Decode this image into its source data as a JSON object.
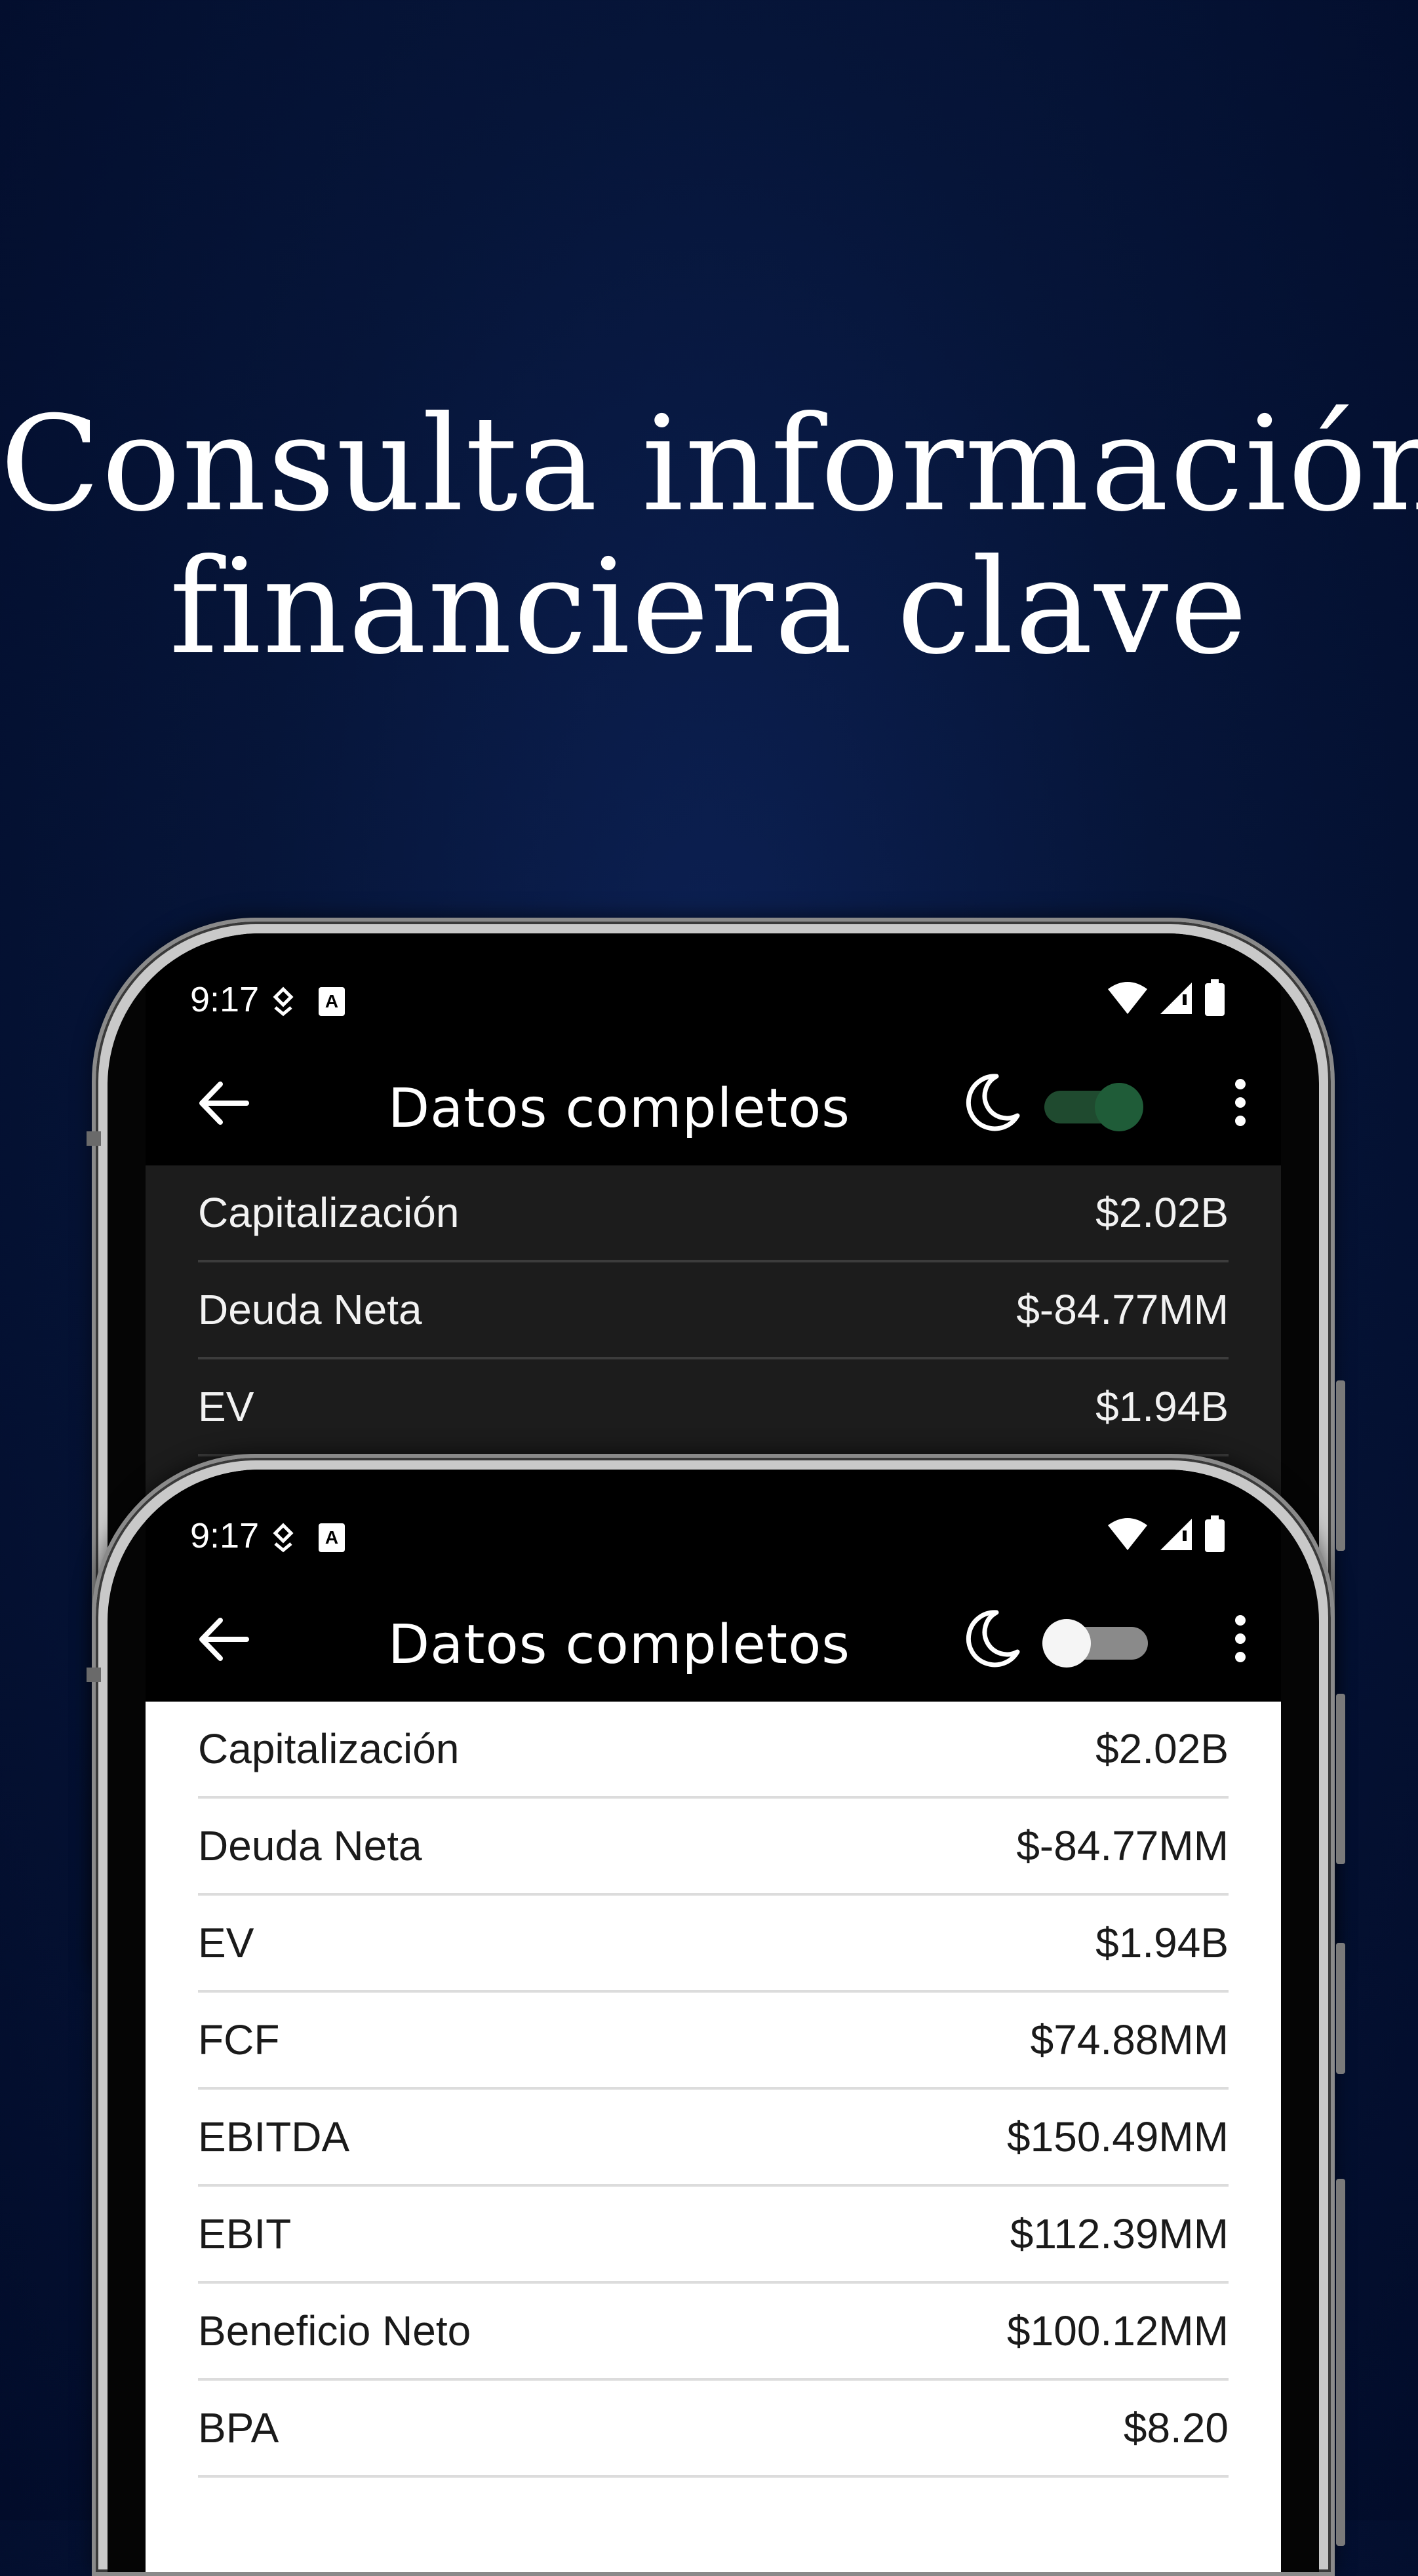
{
  "headline": {
    "line1": "Consulta información",
    "line2": "financiera clave"
  },
  "status_bar": {
    "time": "9:17",
    "icons": [
      "notification-icon",
      "a-icon",
      "wifi-icon",
      "signal-icon",
      "battery-icon"
    ]
  },
  "app_bar": {
    "title": "Datos completos",
    "icons": [
      "back-arrow-icon",
      "moon-icon",
      "more-vert-icon"
    ]
  },
  "dark_phone": {
    "dark_mode_enabled": true,
    "toggle_color": "#1f5c38",
    "rows": [
      {
        "label": "Capitalización",
        "value": "$2.02B"
      },
      {
        "label": "Deuda Neta",
        "value": "$-84.77MM"
      },
      {
        "label": "EV",
        "value": "$1.94B"
      }
    ]
  },
  "light_phone": {
    "dark_mode_enabled": false,
    "rows": [
      {
        "label": "Capitalización",
        "value": "$2.02B"
      },
      {
        "label": "Deuda Neta",
        "value": "$-84.77MM"
      },
      {
        "label": "EV",
        "value": "$1.94B"
      },
      {
        "label": "FCF",
        "value": "$74.88MM"
      },
      {
        "label": "EBITDA",
        "value": "$150.49MM"
      },
      {
        "label": "EBIT",
        "value": "$112.39MM"
      },
      {
        "label": "Beneficio Neto",
        "value": "$100.12MM"
      },
      {
        "label": "BPA",
        "value": "$8.20"
      }
    ]
  },
  "colors": {
    "background": "#061539",
    "dark_surface": "#1c1c1c",
    "light_surface": "#ffffff"
  }
}
